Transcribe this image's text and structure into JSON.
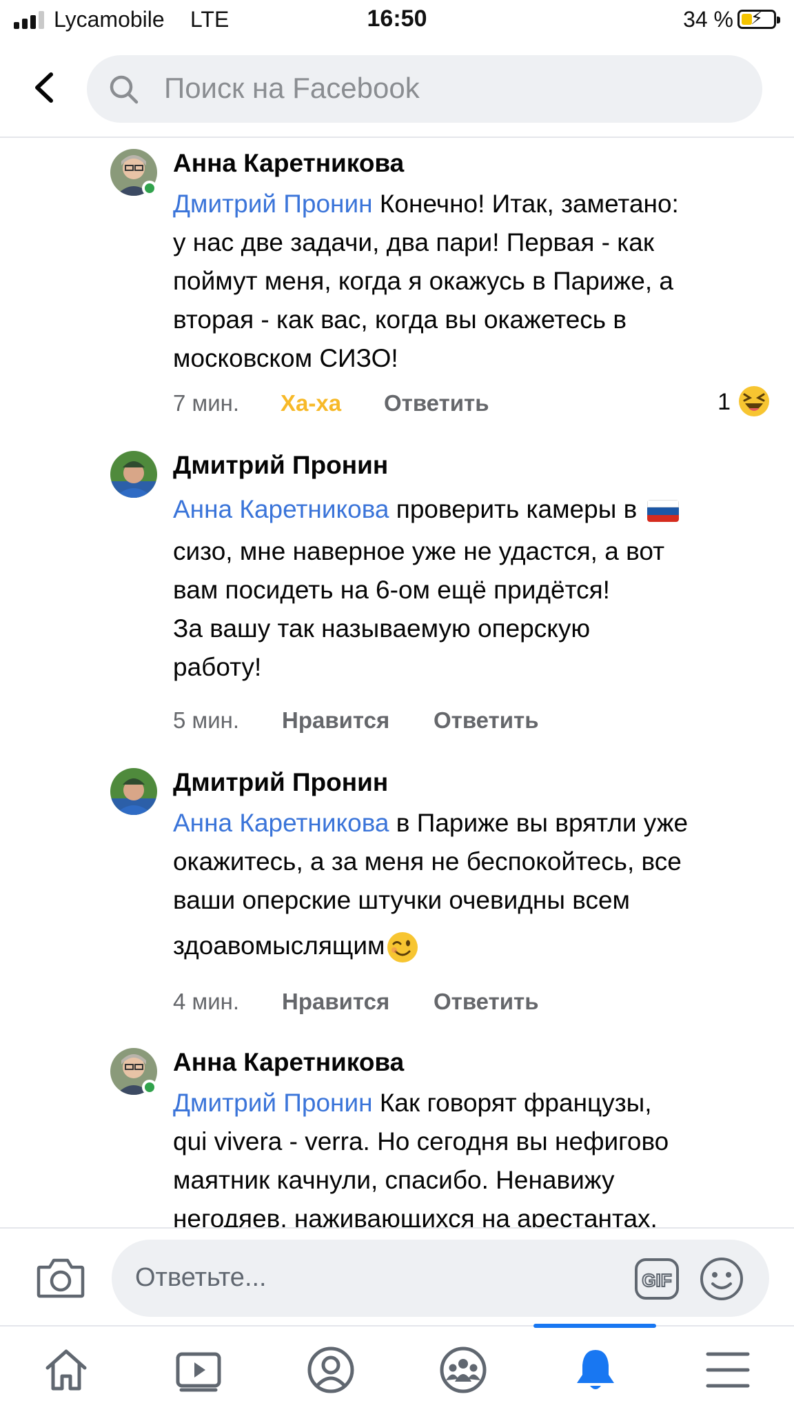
{
  "status_bar": {
    "carrier": "Lycamobile",
    "network": "LTE",
    "time": "16:50",
    "battery": "34 %",
    "battery_level": 0.34
  },
  "search": {
    "placeholder": "Поиск на Facebook"
  },
  "icons": {
    "back": "chevron-left-icon",
    "search": "search-icon",
    "camera": "camera-icon",
    "gif": "gif-icon",
    "smile": "smile-icon",
    "tabs": [
      "home-icon",
      "video-icon",
      "profile-icon",
      "groups-icon",
      "bell-icon",
      "menu-icon"
    ]
  },
  "colors": {
    "mention": "#3a74d9",
    "haha": "#f7b928",
    "active_tab": "#1877f2",
    "online": "#31a24c"
  },
  "comments": [
    {
      "author": "Анна Каретникова",
      "online": true,
      "lines": [
        {
          "mention": "Дмитрий Пронин",
          "text": " Конечно! Итак, заметано:"
        },
        {
          "text": "у нас две задачи, два пари! Первая - как"
        },
        {
          "text": "поймут меня, когда я окажусь в Париже, а"
        },
        {
          "text": "вторая - как вас, когда вы окажетесь в"
        },
        {
          "text": "московском СИЗО!"
        }
      ],
      "time": "7 мин.",
      "reaction_label": "Ха-ха",
      "reply_label": "Ответить",
      "reaction_count": "1",
      "reaction_icon": "laughing-emoji-icon"
    },
    {
      "author": "Дмитрий Пронин",
      "online": false,
      "lines": [
        {
          "mention": "Анна Каретникова",
          "text": " проверить камеры в ",
          "emoji": "russia-flag-icon"
        },
        {
          "text": "сизо, мне наверное уже не удастся, а вот"
        },
        {
          "text": "вам посидеть на 6-ом ещё придётся!"
        },
        {
          "text": "За вашу так называемую оперскую"
        },
        {
          "text": "работу!"
        }
      ],
      "time": "5 мин.",
      "reaction_label": "Нравится",
      "reply_label": "Ответить"
    },
    {
      "author": "Дмитрий Пронин",
      "online": false,
      "lines": [
        {
          "mention": "Анна Каретникова",
          "text": " в Париже вы врятли уже"
        },
        {
          "text": "окажитесь, а за меня не беспокойтесь, все"
        },
        {
          "text": "ваши оперские штучки очевидны всем"
        },
        {
          "text": "здоавомыслящим",
          "emoji": "winking-emoji-icon"
        }
      ],
      "time": "4 мин.",
      "reaction_label": "Нравится",
      "reply_label": "Ответить"
    },
    {
      "author": "Анна Каретникова",
      "online": true,
      "lines": [
        {
          "mention": "Дмитрий Пронин",
          "text": " Как говорят французы,"
        },
        {
          "text": "qui vivera - verra. Но сегодня вы нефигово"
        },
        {
          "text": "маятник качнули, спасибо. Ненавижу"
        },
        {
          "text": "негодяев, наживающихся на арестантах."
        }
      ]
    }
  ],
  "reply_bar": {
    "placeholder": "Ответьте...",
    "gif_label": "GIF"
  },
  "tab_bar": {
    "active_index": 4
  }
}
